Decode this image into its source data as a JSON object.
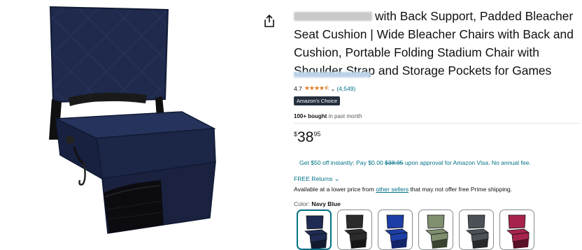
{
  "product": {
    "title_rest": "with Back Support, Padded Bleacher Seat Cushion | Wide Bleacher Chairs with Back and Cushion, Portable Folding Stadium Chair with Shoulder Strap and Storage Pockets for Games",
    "rating": "4.7",
    "review_count": "(4,549)",
    "badge": "Amazon's Choice",
    "bought_bold": "100+ bought",
    "bought_rest": " in past month"
  },
  "price": {
    "symbol": "$",
    "whole": "38",
    "cents": "95"
  },
  "offer": {
    "text_before": "Get $50 off instantly: Pay $0.00 ",
    "old_price": "$38.95",
    "text_after": " upon approval for Amazon Visa. No annual fee."
  },
  "returns": {
    "label": "FREE Returns"
  },
  "lower_price": {
    "before": "Available at a lower price from ",
    "link": "other sellers",
    "after": " that may not offer free Prime shipping."
  },
  "color": {
    "label": "Color: ",
    "selected": "Navy Blue",
    "swatches": [
      {
        "color": "#1f2b52",
        "pocket": "#141a2e"
      },
      {
        "color": "#2b2b2b",
        "pocket": "#161616"
      },
      {
        "color": "#1c3ea6",
        "pocket": "#14256a"
      },
      {
        "color": "#7f8f6f",
        "pocket": "#3a4230"
      },
      {
        "color": "#4b5156",
        "pocket": "#25292c"
      },
      {
        "color": "#a8234b",
        "pocket": "#5a1026"
      }
    ]
  },
  "colors": {
    "link": "#007185",
    "star": "#de7921",
    "badge_bg": "#232f3e",
    "chair_navy": "#1f2a4d"
  },
  "icons": [
    "share-icon",
    "chevron-down-icon",
    "star-icon"
  ]
}
